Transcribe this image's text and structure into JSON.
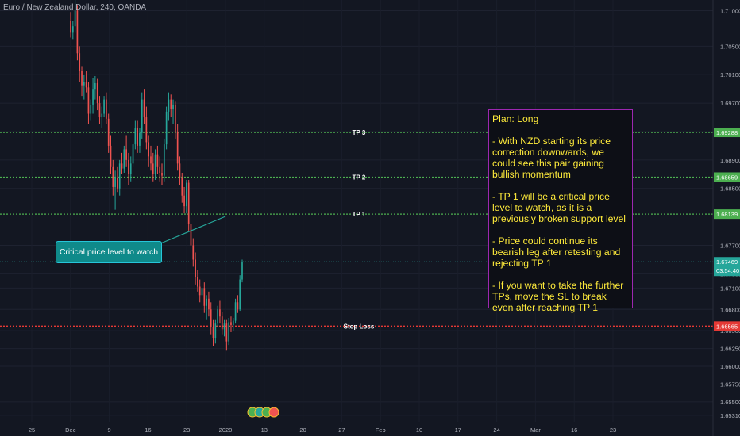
{
  "header": {
    "title": "Euro / New Zealand Dollar, 240, OANDA"
  },
  "plan": {
    "title": "Plan: Long",
    "paragraphs": [
      "- With NZD starting its price correction downwards, we could see this pair gaining bullish momentum",
      "- TP 1 will be a critical price level to watch, as it is a previously broken support level",
      "- Price could continue its bearish leg after retesting and rejecting TP 1",
      "- If you want to take the further TPs, move the SL to break even after reaching TP 1"
    ]
  },
  "callout": {
    "text": "Critical price level to watch"
  },
  "colors": {
    "background": "#131722",
    "up_candle": "#26a69a",
    "down_candle": "#ef5350",
    "tp_line": "#4caf50",
    "stop_line": "#e53935",
    "current_line": "#26a69a",
    "plan_border": "#9c27b0",
    "plan_text": "#ffeb3b",
    "callout_fill": "#0f8a8a"
  },
  "chart_data": {
    "type": "candlestick",
    "title": "Euro / New Zealand Dollar, 240, OANDA",
    "ylim": [
      1.6522,
      1.7115
    ],
    "y_ticks": [
      "1.71000",
      "1.70500",
      "1.70100",
      "1.69700",
      "1.69300",
      "1.68900",
      "1.68500",
      "1.67700",
      "1.67300",
      "1.67100",
      "1.66800",
      "1.66500",
      "1.66250",
      "1.66000",
      "1.65750",
      "1.65500",
      "1.65310"
    ],
    "x_ticks": [
      "25",
      "Dec",
      "9",
      "16",
      "23",
      "2020",
      "13",
      "20",
      "27",
      "Feb",
      "10",
      "17",
      "24",
      "Mar",
      "16",
      "23"
    ],
    "levels": [
      {
        "label": "TP 3",
        "value": 1.69288,
        "price_tag": "1.69288",
        "color": "#4caf50"
      },
      {
        "label": "TP 2",
        "value": 1.68659,
        "price_tag": "1.68659",
        "color": "#4caf50"
      },
      {
        "label": "TP 1",
        "value": 1.68139,
        "price_tag": "1.68139",
        "color": "#4caf50"
      },
      {
        "label": "Stop Loss",
        "value": 1.66565,
        "price_tag": "1.66565",
        "color": "#e53935"
      }
    ],
    "current_price": {
      "value": 1.67469,
      "price_tag": "1.67469",
      "countdown": "03:54:40"
    },
    "candles": [
      [
        1.7086,
        1.7098,
        1.7062,
        1.707
      ],
      [
        1.707,
        1.7085,
        1.706,
        1.7078
      ],
      [
        1.7078,
        1.7115,
        1.707,
        1.71
      ],
      [
        1.71,
        1.7108,
        1.703,
        1.704
      ],
      [
        1.704,
        1.705,
        1.7,
        1.7015
      ],
      [
        1.7015,
        1.7022,
        1.698,
        1.6995
      ],
      [
        1.6995,
        1.701,
        1.6975,
        1.7
      ],
      [
        1.7,
        1.7015,
        1.6985,
        1.6992
      ],
      [
        1.6992,
        1.7,
        1.694,
        1.6955
      ],
      [
        1.6955,
        1.6975,
        1.6945,
        1.6968
      ],
      [
        1.6968,
        1.7005,
        1.6955,
        1.699
      ],
      [
        1.699,
        1.7008,
        1.6975,
        1.6998
      ],
      [
        1.6998,
        1.7004,
        1.696,
        1.697
      ],
      [
        1.697,
        1.698,
        1.694,
        1.695
      ],
      [
        1.695,
        1.6965,
        1.6935,
        1.6955
      ],
      [
        1.6955,
        1.698,
        1.695,
        1.6975
      ],
      [
        1.6975,
        1.6985,
        1.694,
        1.6948
      ],
      [
        1.6948,
        1.6955,
        1.69,
        1.691
      ],
      [
        1.691,
        1.6925,
        1.687,
        1.688
      ],
      [
        1.688,
        1.689,
        1.684,
        1.6852
      ],
      [
        1.6852,
        1.6875,
        1.682,
        1.6865
      ],
      [
        1.6865,
        1.688,
        1.6845,
        1.685
      ],
      [
        1.685,
        1.689,
        1.684,
        1.6885
      ],
      [
        1.6885,
        1.69,
        1.687,
        1.6878
      ],
      [
        1.6878,
        1.691,
        1.6872,
        1.6905
      ],
      [
        1.6905,
        1.6925,
        1.688,
        1.689
      ],
      [
        1.689,
        1.69,
        1.6855,
        1.687
      ],
      [
        1.687,
        1.6895,
        1.686,
        1.6885
      ],
      [
        1.6885,
        1.6915,
        1.688,
        1.6912
      ],
      [
        1.6912,
        1.6945,
        1.6905,
        1.6935
      ],
      [
        1.6935,
        1.6945,
        1.69,
        1.691
      ],
      [
        1.691,
        1.6935,
        1.69,
        1.6928
      ],
      [
        1.6928,
        1.6985,
        1.692,
        1.6975
      ],
      [
        1.6975,
        1.699,
        1.694,
        1.695
      ],
      [
        1.695,
        1.6965,
        1.6905,
        1.6915
      ],
      [
        1.6915,
        1.6925,
        1.688,
        1.6895
      ],
      [
        1.6895,
        1.691,
        1.6875,
        1.6885
      ],
      [
        1.6885,
        1.69,
        1.686,
        1.687
      ],
      [
        1.687,
        1.6905,
        1.6862,
        1.6898
      ],
      [
        1.6898,
        1.691,
        1.687,
        1.688
      ],
      [
        1.688,
        1.6895,
        1.686,
        1.6872
      ],
      [
        1.6872,
        1.6885,
        1.6855,
        1.6868
      ],
      [
        1.6868,
        1.692,
        1.686,
        1.6912
      ],
      [
        1.6912,
        1.6965,
        1.6905,
        1.6958
      ],
      [
        1.6958,
        1.6985,
        1.6945,
        1.6975
      ],
      [
        1.6975,
        1.6982,
        1.695,
        1.6962
      ],
      [
        1.6962,
        1.6975,
        1.694,
        1.6968
      ],
      [
        1.6968,
        1.6972,
        1.692,
        1.693
      ],
      [
        1.693,
        1.694,
        1.6875,
        1.6885
      ],
      [
        1.6885,
        1.6895,
        1.6855,
        1.6865
      ],
      [
        1.6865,
        1.6872,
        1.683,
        1.684
      ],
      [
        1.684,
        1.6852,
        1.6815,
        1.6825
      ],
      [
        1.6825,
        1.6862,
        1.6815,
        1.6858
      ],
      [
        1.6858,
        1.6862,
        1.679,
        1.68
      ],
      [
        1.68,
        1.681,
        1.676,
        1.677
      ],
      [
        1.677,
        1.678,
        1.674,
        1.675
      ],
      [
        1.675,
        1.676,
        1.6715,
        1.6725
      ],
      [
        1.6725,
        1.6735,
        1.6705,
        1.6712
      ],
      [
        1.6712,
        1.6722,
        1.669,
        1.67
      ],
      [
        1.67,
        1.6715,
        1.668,
        1.671
      ],
      [
        1.671,
        1.6718,
        1.6675,
        1.6685
      ],
      [
        1.6685,
        1.67,
        1.6665,
        1.6695
      ],
      [
        1.6695,
        1.6705,
        1.667,
        1.668
      ],
      [
        1.668,
        1.669,
        1.6645,
        1.6655
      ],
      [
        1.6655,
        1.6665,
        1.6628,
        1.664
      ],
      [
        1.664,
        1.6665,
        1.6632,
        1.666
      ],
      [
        1.666,
        1.6685,
        1.6655,
        1.668
      ],
      [
        1.668,
        1.6692,
        1.666,
        1.667
      ],
      [
        1.667,
        1.6676,
        1.6645,
        1.6652
      ],
      [
        1.6652,
        1.6665,
        1.6642,
        1.666
      ],
      [
        1.666,
        1.6665,
        1.6622,
        1.6635
      ],
      [
        1.6635,
        1.6668,
        1.663,
        1.6662
      ],
      [
        1.6662,
        1.667,
        1.6648,
        1.6658
      ],
      [
        1.6658,
        1.6668,
        1.665,
        1.6664
      ],
      [
        1.6664,
        1.6695,
        1.666,
        1.669
      ],
      [
        1.669,
        1.67,
        1.6675,
        1.668
      ],
      [
        1.668,
        1.6728,
        1.6678,
        1.6722
      ],
      [
        1.6722,
        1.675,
        1.6718,
        1.6747
      ]
    ]
  }
}
